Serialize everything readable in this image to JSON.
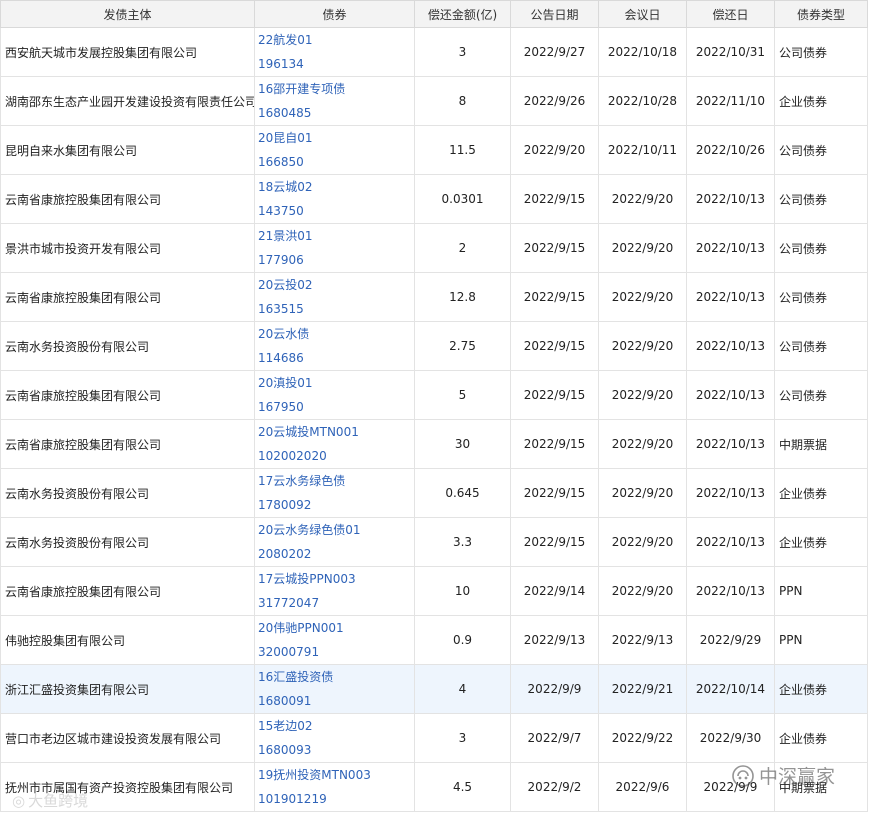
{
  "headers": [
    "发债主体",
    "债券",
    "偿还金额(亿)",
    "公告日期",
    "会议日",
    "偿还日",
    "债券类型"
  ],
  "rows": [
    {
      "issuer": "西安航天城市发展控股集团有限公司",
      "bond_name": "22航发01",
      "bond_code": "196134",
      "amount": "3",
      "notice_date": "2022/9/27",
      "meeting_date": "2022/10/18",
      "repay_date": "2022/10/31",
      "type": "公司债券"
    },
    {
      "issuer": "湖南邵东生态产业园开发建设投资有限责任公司",
      "bond_name": "16邵开建专项债",
      "bond_code": "1680485",
      "amount": "8",
      "notice_date": "2022/9/26",
      "meeting_date": "2022/10/28",
      "repay_date": "2022/11/10",
      "type": "企业债券"
    },
    {
      "issuer": "昆明自来水集团有限公司",
      "bond_name": "20昆自01",
      "bond_code": "166850",
      "amount": "11.5",
      "notice_date": "2022/9/20",
      "meeting_date": "2022/10/11",
      "repay_date": "2022/10/26",
      "type": "公司债券"
    },
    {
      "issuer": "云南省康旅控股集团有限公司",
      "bond_name": "18云城02",
      "bond_code": "143750",
      "amount": "0.0301",
      "notice_date": "2022/9/15",
      "meeting_date": "2022/9/20",
      "repay_date": "2022/10/13",
      "type": "公司债券"
    },
    {
      "issuer": "景洪市城市投资开发有限公司",
      "bond_name": "21景洪01",
      "bond_code": "177906",
      "amount": "2",
      "notice_date": "2022/9/15",
      "meeting_date": "2022/9/20",
      "repay_date": "2022/10/13",
      "type": "公司债券"
    },
    {
      "issuer": "云南省康旅控股集团有限公司",
      "bond_name": "20云投02",
      "bond_code": "163515",
      "amount": "12.8",
      "notice_date": "2022/9/15",
      "meeting_date": "2022/9/20",
      "repay_date": "2022/10/13",
      "type": "公司债券"
    },
    {
      "issuer": "云南水务投资股份有限公司",
      "bond_name": "20云水债",
      "bond_code": "114686",
      "amount": "2.75",
      "notice_date": "2022/9/15",
      "meeting_date": "2022/9/20",
      "repay_date": "2022/10/13",
      "type": "公司债券"
    },
    {
      "issuer": "云南省康旅控股集团有限公司",
      "bond_name": "20滇投01",
      "bond_code": "167950",
      "amount": "5",
      "notice_date": "2022/9/15",
      "meeting_date": "2022/9/20",
      "repay_date": "2022/10/13",
      "type": "公司债券"
    },
    {
      "issuer": "云南省康旅控股集团有限公司",
      "bond_name": "20云城投MTN001",
      "bond_code": "102002020",
      "amount": "30",
      "notice_date": "2022/9/15",
      "meeting_date": "2022/9/20",
      "repay_date": "2022/10/13",
      "type": "中期票据"
    },
    {
      "issuer": "云南水务投资股份有限公司",
      "bond_name": "17云水务绿色债",
      "bond_code": "1780092",
      "amount": "0.645",
      "notice_date": "2022/9/15",
      "meeting_date": "2022/9/20",
      "repay_date": "2022/10/13",
      "type": "企业债券"
    },
    {
      "issuer": "云南水务投资股份有限公司",
      "bond_name": "20云水务绿色债01",
      "bond_code": "2080202",
      "amount": "3.3",
      "notice_date": "2022/9/15",
      "meeting_date": "2022/9/20",
      "repay_date": "2022/10/13",
      "type": "企业债券"
    },
    {
      "issuer": "云南省康旅控股集团有限公司",
      "bond_name": "17云城投PPN003",
      "bond_code": "31772047",
      "amount": "10",
      "notice_date": "2022/9/14",
      "meeting_date": "2022/9/20",
      "repay_date": "2022/10/13",
      "type": "PPN"
    },
    {
      "issuer": "伟驰控股集团有限公司",
      "bond_name": "20伟驰PPN001",
      "bond_code": "32000791",
      "amount": "0.9",
      "notice_date": "2022/9/13",
      "meeting_date": "2022/9/13",
      "repay_date": "2022/9/29",
      "type": "PPN"
    },
    {
      "issuer": "浙江汇盛投资集团有限公司",
      "bond_name": "16汇盛投资债",
      "bond_code": "1680091",
      "amount": "4",
      "notice_date": "2022/9/9",
      "meeting_date": "2022/9/21",
      "repay_date": "2022/10/14",
      "type": "企业债券"
    },
    {
      "issuer": "营口市老边区城市建设投资发展有限公司",
      "bond_name": "15老边02",
      "bond_code": "1680093",
      "amount": "3",
      "notice_date": "2022/9/7",
      "meeting_date": "2022/9/22",
      "repay_date": "2022/9/30",
      "type": "企业债券"
    },
    {
      "issuer": "抚州市市属国有资产投资控股集团有限公司",
      "bond_name": "19抚州投资MTN003",
      "bond_code": "101901219",
      "amount": "4.5",
      "notice_date": "2022/9/2",
      "meeting_date": "2022/9/6",
      "repay_date": "2022/9/9",
      "type": "中期票据"
    }
  ],
  "highlight_row": 13,
  "watermark_right": "中深赢家",
  "watermark_left": "大鱼跨境",
  "colors": {
    "link": "#2f63b8",
    "highlight": "#eef5fd",
    "header_bg": "#f3f3f3"
  }
}
